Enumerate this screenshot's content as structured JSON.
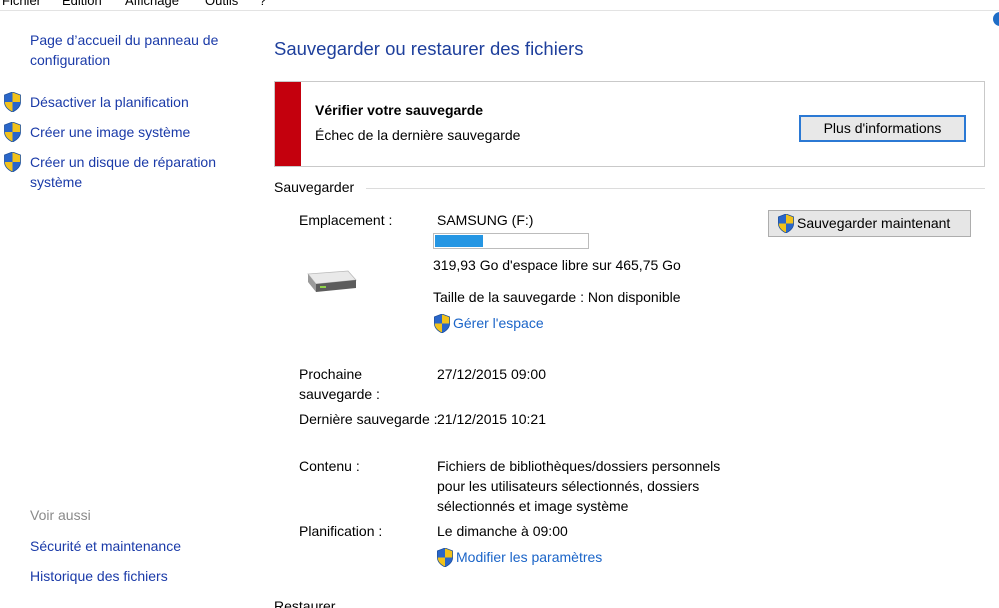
{
  "menubar": {
    "items": [
      "Fichier",
      "Edition",
      "Affichage",
      "Outils",
      "?"
    ]
  },
  "sidebar": {
    "home_link": "Page d’accueil du panneau de configuration",
    "items": [
      {
        "label": "Désactiver la planification"
      },
      {
        "label": "Créer une image système"
      },
      {
        "label": "Créer un disque de réparation système"
      }
    ],
    "see_also_title": "Voir aussi",
    "see_also": [
      "Sécurité et maintenance",
      "Historique des fichiers"
    ]
  },
  "main": {
    "title": "Sauvegarder ou restaurer des fichiers",
    "alert": {
      "title": "Vérifier votre sauvegarde",
      "message": "Échec de la dernière sauvegarde",
      "button": "Plus d'informations",
      "color": "#c4000d"
    },
    "backup_section": {
      "title": "Sauvegarder",
      "location_label": "Emplacement :",
      "location_value": "SAMSUNG (F:)",
      "space_used_fraction": 0.313,
      "free_space": "319,93 Go d'espace libre sur 465,75 Go",
      "backup_size": "Taille de la sauvegarde : Non disponible",
      "manage_space_link": "Gérer l'espace",
      "backup_now_button": "Sauvegarder maintenant",
      "next_backup_label": "Prochaine sauvegarde :",
      "next_backup_value": "27/12/2015 09:00",
      "last_backup_label": "Dernière sauvegarde :",
      "last_backup_value": "21/12/2015 10:21",
      "contents_label": "Contenu :",
      "contents_value": "Fichiers de bibliothèques/dossiers personnels pour les utilisateurs sélectionnés, dossiers sélectionnés et image système",
      "schedule_label": "Planification :",
      "schedule_value": "Le dimanche à 09:00",
      "change_settings_link": "Modifier les paramètres"
    },
    "restore_section": {
      "title": "Restaurer"
    }
  },
  "colors": {
    "link": "#1a64c8",
    "title": "#1e3f9c",
    "progress": "#2596e3",
    "shield_blue": "#2a66c9",
    "shield_yellow": "#f2c21a"
  }
}
